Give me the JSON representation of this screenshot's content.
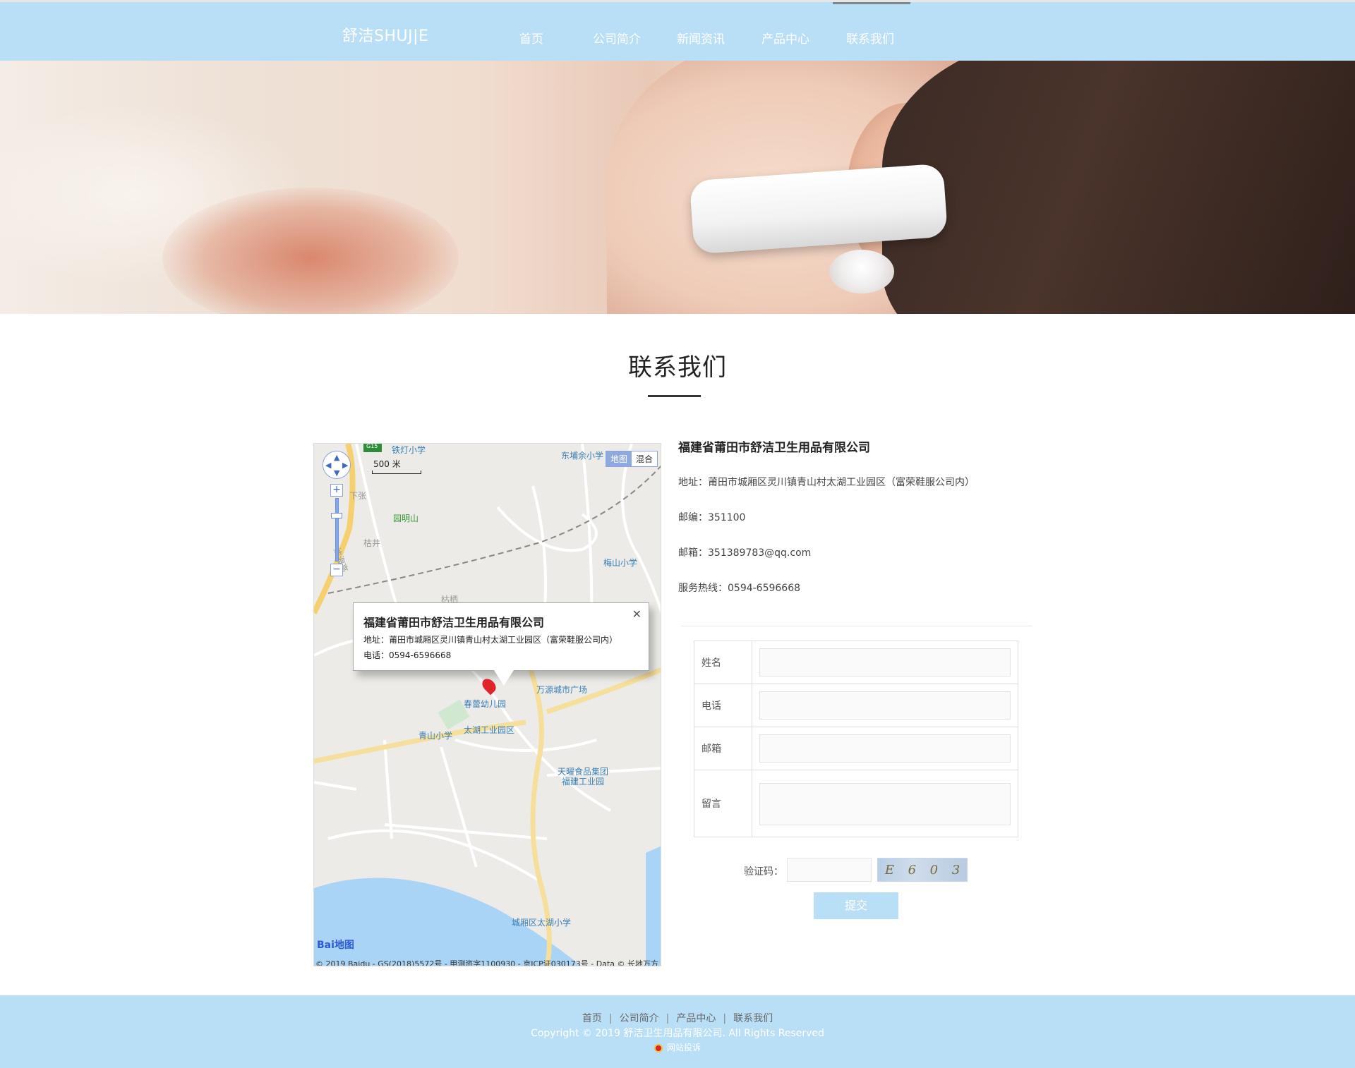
{
  "header": {
    "logo": "舒洁SHUJ|E",
    "nav": [
      "首页",
      "公司简介",
      "新闻资讯",
      "产品中心",
      "联系我们"
    ]
  },
  "page_title": "联系我们",
  "map": {
    "type_toggle": [
      "地图",
      "混合"
    ],
    "scale": "500 米",
    "labels": {
      "tieshan": "铁灯小学",
      "dongpu": "东埔余小学",
      "yuanming": "园明山",
      "xiazhang": "下张",
      "kujing": "枯井",
      "shenhai": "沈海高",
      "meishan": "梅山小学",
      "guqi": "枯栖",
      "wanyuan": "万源城市广场",
      "chunlei": "春蕾幼儿园",
      "qingshan": "青山小学",
      "taihu_park": "太湖工业园区",
      "tianyao": "天曜食品集团",
      "tianyao2": "福建工业园",
      "taihu_school": "城厢区太湖小学",
      "g15": "G15"
    },
    "info_window": {
      "title": "福建省莆田市舒洁卫生用品有限公司",
      "address": "地址：莆田市城厢区灵川镇青山村太湖工业园区（富荣鞋服公司内）",
      "phone": "电话：0594-6596668"
    },
    "logo_text": "Bai",
    "logo_text2": "地图",
    "copyright": "© 2019 Baidu - GS(2018)5572号 - 甲测资字1100930 - 京ICP证030173号 - Data © 长地万方"
  },
  "contact": {
    "company": "福建省莆田市舒洁卫生用品有限公司",
    "address": "地址：莆田市城厢区灵川镇青山村太湖工业园区（富荣鞋服公司内）",
    "postcode": "邮编：351100",
    "email": "邮箱：351389783@qq.com",
    "hotline": "服务热线：0594-6596668"
  },
  "form": {
    "name_label": "姓名",
    "phone_label": "电话",
    "email_label": "邮箱",
    "message_label": "留言",
    "captcha_label": "验证码：",
    "captcha_chars": [
      "E",
      "6",
      "0",
      "3"
    ],
    "submit": "提交"
  },
  "footer": {
    "links": [
      "首页",
      "公司简介",
      "产品中心",
      "联系我们"
    ],
    "copyright": "Copyright © 2019 舒洁卫生用品有限公司. All Rights Reserved",
    "report": "网站投诉"
  },
  "colors": {
    "header_bg": "#b9dff6",
    "footer_bg": "#b9dff6",
    "button_bg": "#b9dff6"
  }
}
